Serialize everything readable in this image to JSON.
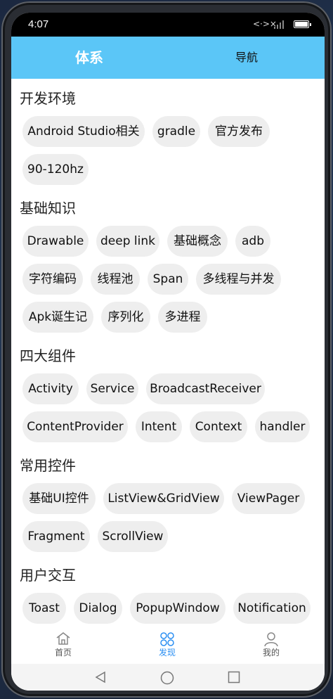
{
  "status": {
    "time": "4:07",
    "net_glyph": "<·>×"
  },
  "topbar": {
    "tab_active": "体系",
    "tab_other": "导航"
  },
  "categories": [
    {
      "title": "开发环境",
      "items": [
        "Android Studio相关",
        "gradle",
        "官方发布",
        "90-120hz"
      ]
    },
    {
      "title": "基础知识",
      "items": [
        "Drawable",
        "deep link",
        "基础概念",
        "adb",
        "字符编码",
        "线程池",
        "Span",
        "多线程与并发",
        "Apk诞生记",
        "序列化",
        "多进程"
      ]
    },
    {
      "title": "四大组件",
      "items": [
        "Activity",
        "Service",
        "BroadcastReceiver",
        "ContentProvider",
        "Intent",
        "Context",
        "handler"
      ]
    },
    {
      "title": "常用控件",
      "items": [
        "基础UI控件",
        "ListView&GridView",
        "ViewPager",
        "Fragment",
        "ScrollView"
      ]
    },
    {
      "title": "用户交互",
      "items": [
        "Toast",
        "Dialog",
        "PopupWindow",
        "Notification"
      ]
    }
  ],
  "bottom_nav": {
    "home": {
      "label": "首页",
      "icon": "home-icon"
    },
    "discover": {
      "label": "发现",
      "icon": "discover-icon"
    },
    "mine": {
      "label": "我的",
      "icon": "person-icon"
    }
  },
  "colors": {
    "accent": "#5bc6f7",
    "chip_bg": "#eeeeee",
    "nav_active": "#2b8ff2"
  }
}
